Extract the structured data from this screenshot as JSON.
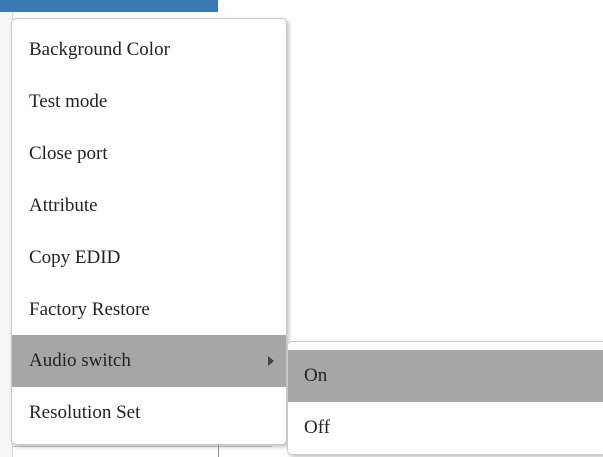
{
  "context_menu": {
    "items": [
      {
        "label": "Background Color"
      },
      {
        "label": "Test mode"
      },
      {
        "label": "Close port"
      },
      {
        "label": "Attribute"
      },
      {
        "label": "Copy EDID"
      },
      {
        "label": "Factory Restore"
      },
      {
        "label": "Audio switch",
        "has_submenu": true,
        "highlighted": true
      },
      {
        "label": "Resolution Set"
      }
    ]
  },
  "submenu": {
    "items": [
      {
        "label": "On",
        "highlighted": true
      },
      {
        "label": "Off"
      }
    ]
  },
  "colors": {
    "highlight": "#a6a6a6",
    "menu_background": "#ffffff",
    "text": "#222222",
    "underlay_accent": "#3b79b3"
  },
  "icons": {
    "submenu_indicator": "chevron-right-icon"
  }
}
